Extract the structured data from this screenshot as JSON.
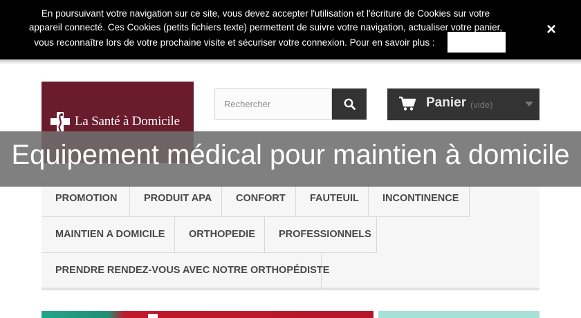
{
  "cookie": {
    "line1": "En poursuivant votre navigation sur ce site, vous devez accepter l'utilisation et l'écriture de Cookies sur votre",
    "line2": "appareil connecté. Ces Cookies (petits fichiers texte) permettent de suivre votre navigation, actualiser votre panier,",
    "line3": "vous reconnaître lors de votre prochaine visite et sécuriser votre connexion. Pour en savoir plus :",
    "close_icon": "×"
  },
  "logo": {
    "text": "La Santé à Domicile",
    "color": "#6a1c2c"
  },
  "search": {
    "placeholder": "Rechercher"
  },
  "cart": {
    "label": "Panier",
    "status": "(vide)"
  },
  "page_title": "Equipement médical pour maintien à domicile",
  "nav": {
    "items": [
      "PROMOTION",
      "PRODUIT APA",
      "CONFORT",
      "FAUTEUIL",
      "INCONTINENCE",
      "MAINTIEN A DOMICILE",
      "ORTHOPEDIE",
      "PROFESSIONNELS",
      "PRENDRE RENDEZ-VOUS AVEC NOTRE ORTHOPÉDISTE"
    ]
  }
}
